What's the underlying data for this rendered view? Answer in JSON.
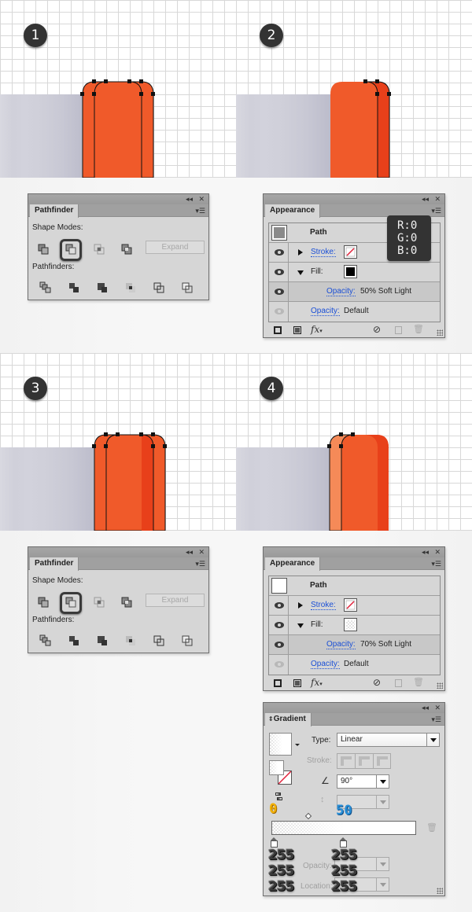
{
  "steps": [
    {
      "number": "1"
    },
    {
      "number": "2"
    },
    {
      "number": "3"
    },
    {
      "number": "4"
    }
  ],
  "colors": {
    "orange_main": "#f05a2a",
    "orange_dark": "#e8401a",
    "orange_light": "#f58a58",
    "gray_block": "#cfcfd9",
    "panel_bg": "#d6d6d6",
    "link_blue": "#1a4fd6"
  },
  "pathfinder_panels": [
    {
      "tab_label": "Pathfinder",
      "shape_modes_label": "Shape Modes:",
      "pathfinders_label": "Pathfinders:",
      "expand_label": "Expand",
      "shape_mode_icons": [
        "unite-icon",
        "minus-front-icon",
        "intersect-icon",
        "exclude-icon"
      ],
      "selected_shape_mode": "minus-front-icon",
      "pathfinder_icons": [
        "divide-icon",
        "trim-icon",
        "merge-icon",
        "crop-icon",
        "outline-icon",
        "minus-back-icon"
      ]
    },
    {
      "tab_label": "Pathfinder",
      "shape_modes_label": "Shape Modes:",
      "pathfinders_label": "Pathfinders:",
      "expand_label": "Expand",
      "shape_mode_icons": [
        "unite-icon",
        "minus-front-icon",
        "intersect-icon",
        "exclude-icon"
      ],
      "selected_shape_mode": "minus-front-icon",
      "pathfinder_icons": [
        "divide-icon",
        "trim-icon",
        "merge-icon",
        "crop-icon",
        "outline-icon",
        "minus-back-icon"
      ]
    }
  ],
  "appearance_panels": [
    {
      "tab_label": "Appearance",
      "object_label": "Path",
      "stroke_label": "Stroke:",
      "fill_label": "Fill:",
      "fill_opacity_label": "Opacity:",
      "fill_opacity_value": "50% Soft Light",
      "opacity_label": "Opacity:",
      "opacity_value": "Default",
      "fill_color": "#000000",
      "thumb_color": "#8a8a8a"
    },
    {
      "tab_label": "Appearance",
      "object_label": "Path",
      "stroke_label": "Stroke:",
      "fill_label": "Fill:",
      "fill_opacity_label": "Opacity:",
      "fill_opacity_value": "70% Soft Light",
      "opacity_label": "Opacity:",
      "opacity_value": "Default",
      "fill_color": "gradient",
      "thumb_color": "#ffffff"
    }
  ],
  "rgb_tooltip": {
    "r": "R:0",
    "g": "G:0",
    "b": "B:0"
  },
  "gradient_panel": {
    "tab_label": "Gradient",
    "type_label": "Type:",
    "type_value": "Linear",
    "stroke_label": "Stroke:",
    "angle_value": "90°",
    "aspect_value": "",
    "opacity_label": "Opacity:",
    "location_label": "Location:",
    "midpoint_annotation": "50",
    "left_stop_annotation": "0",
    "left_stop_rgb": [
      "255",
      "255",
      "255"
    ],
    "right_stop_rgb": [
      "255",
      "255",
      "255"
    ]
  }
}
